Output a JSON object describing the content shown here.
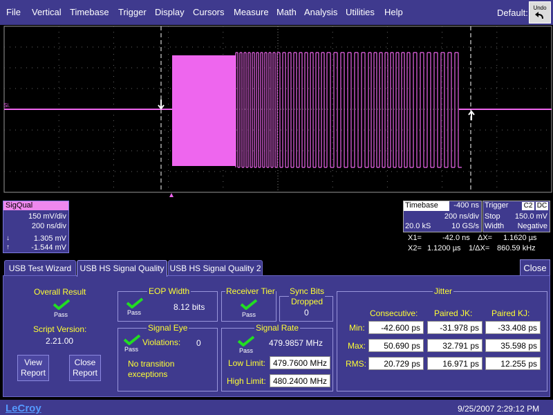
{
  "menu": {
    "items": [
      "File",
      "Vertical",
      "Timebase",
      "Trigger",
      "Display",
      "Cursors",
      "Measure",
      "Math",
      "Analysis",
      "Utilities",
      "Help"
    ],
    "default_label": "Default:",
    "undo_label": "Undo"
  },
  "trace": {
    "label": "Si.",
    "color": "#ee66ee"
  },
  "sigqual": {
    "title": "SigQual",
    "vdiv": "150 mV/div",
    "tdiv": "200 ns/div",
    "up_value": "1.305 mV",
    "down_value": "-1.544 mV"
  },
  "timebase": {
    "label": "Timebase",
    "offset": "-400 ns",
    "tdiv": "200 ns/div",
    "samples": "20.0 kS",
    "rate": "10 GS/s"
  },
  "trigger": {
    "label": "Trigger",
    "channel": "C2",
    "coupling": "DC",
    "mode": "Stop",
    "level": "150.0 mV",
    "type": "Width",
    "slope": "Negative"
  },
  "cursors": {
    "x1_label": "X1=",
    "x1": "-42.0 ns",
    "dx_label": "ΔX=",
    "dx": "1.1620 µs",
    "x2_label": "X2=",
    "x2": "1.1200 µs",
    "inv_label": "1/ΔX=",
    "inv": "860.59 kHz"
  },
  "tabs": [
    "USB Test Wizard",
    "USB HS Signal Quality",
    "USB HS Signal Quality 2"
  ],
  "close_label": "Close",
  "overall": {
    "title": "Overall Result",
    "status": "Pass",
    "script_label": "Script Version:",
    "script_version": "2.21.00",
    "view_report": "View Report",
    "close_report": "Close Report"
  },
  "eop": {
    "title": "EOP Width",
    "status": "Pass",
    "value": "8.12 bits"
  },
  "receiver": {
    "title": "Receiver Tier",
    "status": "Pass"
  },
  "sync": {
    "title": "Sync Bits Dropped",
    "value": "0"
  },
  "eye": {
    "title": "Signal Eye",
    "status": "Pass",
    "violations_label": "Violations:",
    "violations": "0",
    "note": "No transition exceptions"
  },
  "rate": {
    "title": "Signal Rate",
    "status": "Pass",
    "value": "479.9857 MHz",
    "low_label": "Low Limit:",
    "low": "479.7600 MHz",
    "high_label": "High Limit:",
    "high": "480.2400 MHz"
  },
  "jitter": {
    "title": "Jitter",
    "columns": [
      "Consecutive:",
      "Paired JK:",
      "Paired KJ:"
    ],
    "rows": [
      {
        "label": "Min:",
        "values": [
          "-42.600 ps",
          "-31.978 ps",
          "-33.408 ps"
        ]
      },
      {
        "label": "Max:",
        "values": [
          "50.690 ps",
          "32.791 ps",
          "35.598 ps"
        ]
      },
      {
        "label": "RMS:",
        "values": [
          "20.729 ps",
          "16.971 ps",
          "12.255 ps"
        ]
      }
    ]
  },
  "status_bar": {
    "brand": "LeCroy",
    "datetime": "9/25/2007 2:29:12 PM"
  }
}
